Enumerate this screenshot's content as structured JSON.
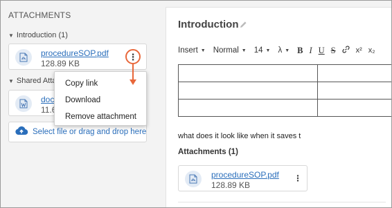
{
  "attachments_panel": {
    "heading": "ATTACHMENTS",
    "groups": [
      {
        "label": "Introduction (1)",
        "caret": "▼"
      },
      {
        "label": "Shared Atta",
        "caret": "▼"
      }
    ],
    "files": [
      {
        "name": "procedureSOP.pdf",
        "size": "128.89 KB",
        "icon": "pdf-file-icon"
      },
      {
        "name": "doc",
        "size": "11.6",
        "icon": "word-file-icon"
      }
    ],
    "kebab": "⋮",
    "context_menu": [
      "Copy link",
      "Download",
      "Remove attachment"
    ],
    "upload_label": "Select file or drag and drop here",
    "highlight_color": "#e8673a"
  },
  "editor": {
    "title": "Introduction",
    "toolbar": {
      "insert": "Insert",
      "style": "Normal",
      "size": "14",
      "lambda": "λ",
      "buttons": [
        "B",
        "I",
        "U",
        "S",
        "x²",
        "x₂"
      ]
    },
    "body_text": "what does it look like when it saves t",
    "attachments_label": "Attachments (1)",
    "attachment": {
      "name": "procedureSOP.pdf",
      "size": "128.89 KB",
      "kebab": "⋮"
    }
  },
  "colors": {
    "link": "#2a6ebb",
    "panel_bg": "#f3f3f3",
    "accent": "#e8673a"
  }
}
